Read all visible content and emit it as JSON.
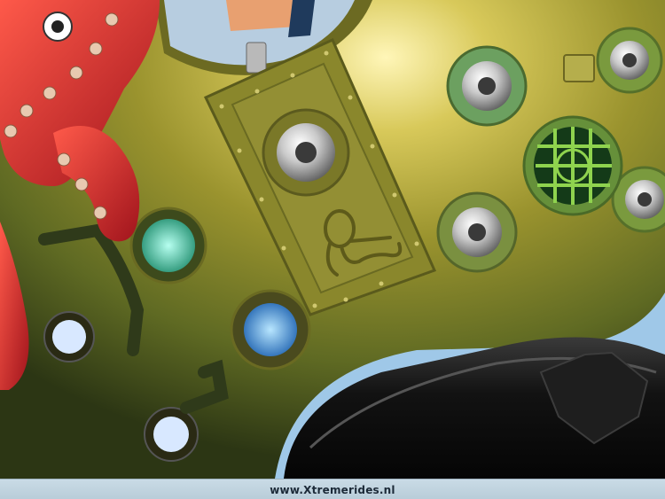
{
  "photo": {
    "subject": "octopus-themed submarine fairground ride gondola",
    "watermark_url": "www.Xtremerides.nl"
  },
  "colors": {
    "hull_gold": "#8f8a2a",
    "hull_shadow": "#3d4a1c",
    "tentacle_red": "#d52a2a",
    "led_green": "#2fe0a8",
    "led_blue": "#2fa8ff",
    "chrome": "#dcdcdc",
    "base_black": "#141414",
    "credit_bar": "#c2d5e0"
  }
}
